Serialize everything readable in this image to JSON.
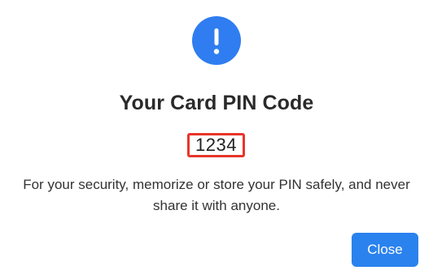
{
  "dialog": {
    "icon": "exclamation-icon",
    "title": "Your Card PIN Code",
    "pin": "1234",
    "message": "For your security, memorize or store your PIN safely, and never share it with anyone.",
    "close_label": "Close"
  },
  "colors": {
    "icon_background": "#2f7df0",
    "pin_highlight_border": "#e8352b",
    "button_background": "#2a82ee",
    "title_text": "#2a2a2a"
  }
}
